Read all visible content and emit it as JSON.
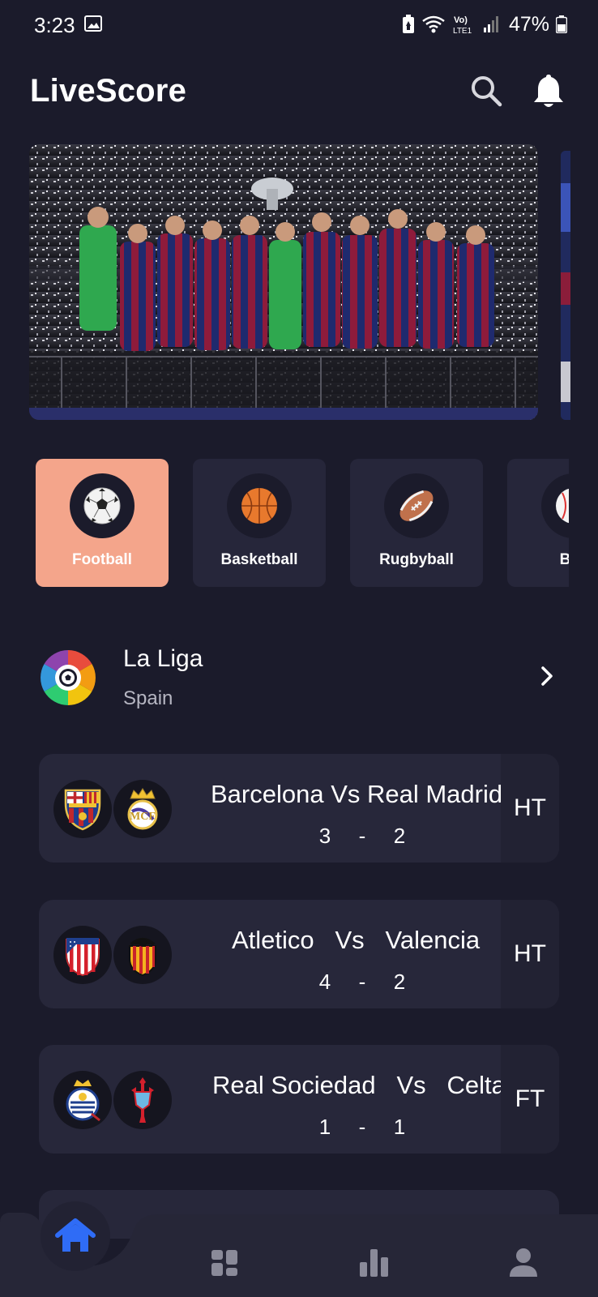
{
  "status_bar": {
    "time": "3:23",
    "battery": "47%",
    "network_label_top": "Vo)",
    "network_label_bottom": "LTE1"
  },
  "app": {
    "title": "LiveScore"
  },
  "header": {
    "search_icon": "search-icon",
    "notification_icon": "bell-icon"
  },
  "hero": {
    "image_subject": "team-celebration-photo"
  },
  "categories": [
    {
      "label": "Football",
      "icon": "soccer-ball-icon",
      "active": true
    },
    {
      "label": "Basketball",
      "icon": "basketball-icon",
      "active": false
    },
    {
      "label": "Rugbyball",
      "icon": "rugby-ball-icon",
      "active": false
    },
    {
      "label": "Bas",
      "icon": "baseball-icon",
      "active": false
    }
  ],
  "league": {
    "name": "La Liga",
    "country": "Spain"
  },
  "matches": [
    {
      "home": "Barcelona",
      "away": "Real Madrid",
      "title": "Barcelona Vs Real Madrid",
      "home_score": "3",
      "separator": "-",
      "away_score": "2",
      "status": "HT"
    },
    {
      "home": "Atletico",
      "away": "Valencia",
      "title": "Atletico   Vs   Valencia",
      "home_score": "4",
      "separator": "-",
      "away_score": "2",
      "status": "HT"
    },
    {
      "home": "Real Sociedad",
      "away": "Celta",
      "title": "Real Sociedad   Vs   Celta",
      "home_score": "1",
      "separator": "-",
      "away_score": "1",
      "status": "FT"
    }
  ],
  "bottom_nav": [
    {
      "name": "home",
      "icon": "home-icon",
      "active": true
    },
    {
      "name": "dashboard",
      "icon": "grid-icon",
      "active": false
    },
    {
      "name": "stats",
      "icon": "bar-chart-icon",
      "active": false
    },
    {
      "name": "profile",
      "icon": "user-icon",
      "active": false
    }
  ],
  "colors": {
    "background": "#1b1b2b",
    "card": "#27273a",
    "accent": "#f4a58b",
    "nav_active": "#2f6cf6",
    "nav_inactive": "#8a8a99",
    "text_secondary": "#b6b6c2"
  }
}
